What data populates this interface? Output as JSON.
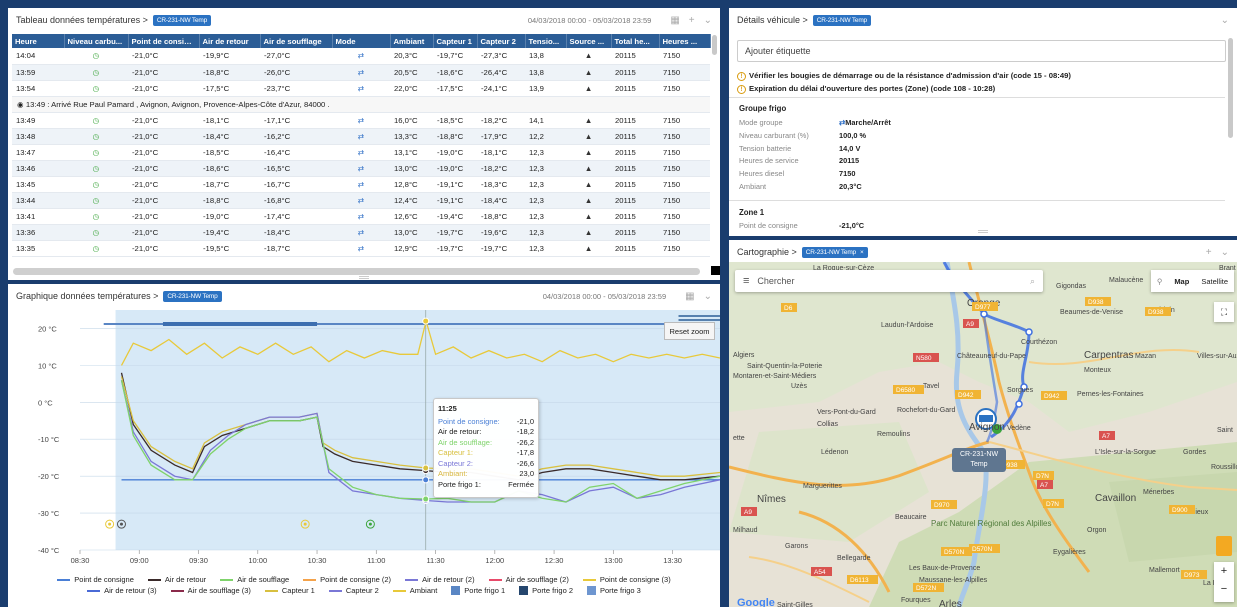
{
  "table_panel": {
    "title": "Tableau données températures >",
    "vehicle_badge": "CR-231-NW Temp",
    "date_range": "04/03/2018 00:00 - 05/03/2018 23:59",
    "columns": [
      "Heure",
      "Niveau carbu...",
      "Point de consign...",
      "Air de retour",
      "Air de soufflage",
      "Mode",
      "Ambiant",
      "Capteur 1",
      "Capteur 2",
      "Tensio...",
      "Source ...",
      "Total he...",
      "Heures ..."
    ],
    "rows_top": [
      [
        "14:04",
        "-21,0°C",
        "-19,9°C",
        "-27,0°C",
        "20,3°C",
        "-19,7°C",
        "-27,3°C",
        "13,8",
        "20115",
        "7150"
      ],
      [
        "13:59",
        "-21,0°C",
        "-18,8°C",
        "-26,0°C",
        "20,5°C",
        "-18,6°C",
        "-26,4°C",
        "13,8",
        "20115",
        "7150"
      ],
      [
        "13:54",
        "-21,0°C",
        "-17,5°C",
        "-23,7°C",
        "22,0°C",
        "-17,5°C",
        "-24,1°C",
        "13,9",
        "20115",
        "7150"
      ]
    ],
    "event_row": "13:49 : Arrivé Rue Paul Pamard , Avignon, Avignon, Provence-Alpes-Côte d'Azur, 84000 .",
    "rows_bottom": [
      [
        "13:49",
        "-21,0°C",
        "-18,1°C",
        "-17,1°C",
        "16,0°C",
        "-18,5°C",
        "-18,2°C",
        "14,1",
        "20115",
        "7150"
      ],
      [
        "13:48",
        "-21,0°C",
        "-18,4°C",
        "-16,2°C",
        "13,3°C",
        "-18,8°C",
        "-17,9°C",
        "12,2",
        "20115",
        "7150"
      ],
      [
        "13:47",
        "-21,0°C",
        "-18,5°C",
        "-16,4°C",
        "13,1°C",
        "-19,0°C",
        "-18,1°C",
        "12,3",
        "20115",
        "7150"
      ],
      [
        "13:46",
        "-21,0°C",
        "-18,6°C",
        "-16,5°C",
        "13,0°C",
        "-19,0°C",
        "-18,2°C",
        "12,3",
        "20115",
        "7150"
      ],
      [
        "13:45",
        "-21,0°C",
        "-18,7°C",
        "-16,7°C",
        "12,8°C",
        "-19,1°C",
        "-18,3°C",
        "12,3",
        "20115",
        "7150"
      ],
      [
        "13:44",
        "-21,0°C",
        "-18,8°C",
        "-16,8°C",
        "12,4°C",
        "-19,1°C",
        "-18,4°C",
        "12,3",
        "20115",
        "7150"
      ],
      [
        "13:41",
        "-21,0°C",
        "-19,0°C",
        "-17,4°C",
        "12,6°C",
        "-19,4°C",
        "-18,8°C",
        "12,3",
        "20115",
        "7150"
      ],
      [
        "13:36",
        "-21,0°C",
        "-19,4°C",
        "-18,4°C",
        "13,0°C",
        "-19,7°C",
        "-19,6°C",
        "12,3",
        "20115",
        "7150"
      ],
      [
        "13:35",
        "-21,0°C",
        "-19,5°C",
        "-18,7°C",
        "12,9°C",
        "-19,7°C",
        "-19,7°C",
        "12,3",
        "20115",
        "7150"
      ]
    ]
  },
  "chart_panel": {
    "title": "Graphique données températures >",
    "vehicle_badge": "CR-231-NW Temp",
    "date_range": "04/03/2018 00:00 - 05/03/2018 23:59",
    "reset_zoom": "Reset zoom",
    "tooltip": {
      "time": "11:25",
      "rows": [
        {
          "label": "Point de consigne:",
          "value": "-21,0",
          "color": "#4a7fd6"
        },
        {
          "label": "Air de retour:",
          "value": "-18,2",
          "color": "#222"
        },
        {
          "label": "Air de soufflage:",
          "value": "-26,2",
          "color": "#7fd36b"
        },
        {
          "label": "Capteur 1:",
          "value": "-17,8",
          "color": "#d8c040"
        },
        {
          "label": "Capteur 2:",
          "value": "-26,6",
          "color": "#7a77d6"
        },
        {
          "label": "Ambiant:",
          "value": "23,0",
          "color": "#d8b740"
        },
        {
          "label": "Porte frigo 1:",
          "value": "Fermée",
          "color": "#222"
        }
      ]
    },
    "legend": [
      {
        "label": "Point de consigne",
        "color": "#4a7fd6",
        "kind": "line"
      },
      {
        "label": "Air de retour",
        "color": "#3a2a2a",
        "kind": "line"
      },
      {
        "label": "Air de soufflage",
        "color": "#7fd36b",
        "kind": "line"
      },
      {
        "label": "Point de consigne (2)",
        "color": "#f4a24a",
        "kind": "line"
      },
      {
        "label": "Air de retour (2)",
        "color": "#7a77d6",
        "kind": "line"
      },
      {
        "label": "Air de soufflage (2)",
        "color": "#e84a6a",
        "kind": "line"
      },
      {
        "label": "Point de consigne (3)",
        "color": "#e8c93a",
        "kind": "line"
      },
      {
        "label": "Air de retour (3)",
        "color": "#4a6ad6",
        "kind": "line"
      },
      {
        "label": "Air de soufflage (3)",
        "color": "#8a2a4a",
        "kind": "line"
      },
      {
        "label": "Capteur 1",
        "color": "#d8c040",
        "kind": "line"
      },
      {
        "label": "Capteur 2",
        "color": "#7a77d6",
        "kind": "line"
      },
      {
        "label": "Ambiant",
        "color": "#e8c93a",
        "kind": "line"
      },
      {
        "label": "Porte frigo 1",
        "color": "#5a86c4",
        "kind": "box"
      },
      {
        "label": "Porte frigo 2",
        "color": "#25466e",
        "kind": "box"
      },
      {
        "label": "Porte frigo 3",
        "color": "#6e96d0",
        "kind": "box"
      }
    ]
  },
  "chart_data": {
    "type": "line",
    "x_ticks": [
      "08:30",
      "09:00",
      "09:30",
      "10:00",
      "10:30",
      "11:00",
      "11:30",
      "12:00",
      "12:30",
      "13:00",
      "13:30"
    ],
    "y_ticks": [
      "20 °C",
      "10 °C",
      "0 °C",
      "-10 °C",
      "-20 °C",
      "-30 °C",
      "-40 °C"
    ],
    "ylim": [
      -40,
      25
    ],
    "xlim_hours": [
      8.5,
      13.9
    ],
    "highlight_range": [
      8.8,
      13.9
    ],
    "crosshair_x": 11.417,
    "series": [
      {
        "name": "Ambiant",
        "color": "#e8c93a",
        "x": [
          8.85,
          8.95,
          9.1,
          9.25,
          9.4,
          9.55,
          9.7,
          9.85,
          10.0,
          10.15,
          10.3,
          10.45,
          10.6,
          10.75,
          10.9,
          11.05,
          11.2,
          11.35,
          11.42,
          11.5,
          11.65,
          11.8,
          11.95,
          12.1,
          12.25,
          12.4,
          12.55,
          12.7,
          12.85,
          13.0,
          13.15,
          13.3,
          13.45,
          13.6,
          13.75,
          13.9
        ],
        "y": [
          10,
          16,
          14,
          17,
          13,
          16,
          12,
          15,
          13,
          16,
          13,
          15,
          11,
          14,
          12,
          14,
          13,
          13,
          22,
          13,
          15,
          12,
          14,
          12,
          13,
          11,
          14,
          12,
          13,
          11,
          13,
          12,
          13,
          12,
          13,
          12
        ]
      },
      {
        "name": "Point de consigne",
        "color": "#4a7fd6",
        "x": [
          8.85,
          13.9
        ],
        "y": [
          -21,
          -21
        ]
      },
      {
        "name": "Air de retour",
        "color": "#3a2a2a",
        "x": [
          8.85,
          8.95,
          9.1,
          9.3,
          9.45,
          9.55,
          9.7,
          9.9,
          10.1,
          10.35,
          10.5,
          10.55,
          10.65,
          10.8,
          11.0,
          11.2,
          11.42,
          11.6,
          11.8,
          12.0,
          12.2,
          12.4,
          12.6,
          12.8,
          13.0,
          13.2,
          13.4,
          13.6,
          13.9
        ],
        "y": [
          8,
          -6,
          -13,
          -17,
          -19,
          -12,
          -9,
          -7,
          -5,
          -5,
          -4,
          -12,
          -14,
          -16,
          -17,
          -18,
          -18.5,
          -19,
          -19,
          -20,
          -21,
          -19,
          -18,
          -18,
          -19,
          -20,
          -21,
          -21,
          -20
        ]
      },
      {
        "name": "Capteur 1",
        "color": "#d8c040",
        "x": [
          8.85,
          8.95,
          9.1,
          9.3,
          9.45,
          9.55,
          9.7,
          9.9,
          10.1,
          10.35,
          10.5,
          10.55,
          10.65,
          10.8,
          11.0,
          11.2,
          11.42,
          11.6,
          11.8,
          12.0,
          12.2,
          12.4,
          12.6,
          12.8,
          13.0,
          13.2,
          13.4,
          13.6,
          13.9
        ],
        "y": [
          7,
          -5,
          -12,
          -16,
          -18,
          -11,
          -8,
          -6,
          -4,
          -4,
          -3,
          -11,
          -13,
          -15,
          -16,
          -17,
          -17.8,
          -18,
          -18,
          -19,
          -20,
          -18,
          -17,
          -17,
          -18,
          -19,
          -20,
          -20,
          -19
        ]
      },
      {
        "name": "Capteur 2",
        "color": "#7a77d6",
        "x": [
          8.85,
          8.95,
          9.1,
          9.3,
          9.45,
          9.6,
          9.75,
          9.9,
          10.1,
          10.35,
          10.5,
          10.6,
          10.8,
          11.0,
          11.2,
          11.42,
          11.6,
          11.8,
          12.0,
          12.2,
          12.4,
          12.6,
          12.8,
          13.0,
          13.2,
          13.4,
          13.6,
          13.9
        ],
        "y": [
          6,
          -8,
          -16,
          -20,
          -21,
          -13,
          -9,
          -6,
          -4,
          -4,
          -3,
          -19,
          -24,
          -25,
          -26,
          -26.6,
          -27,
          -27,
          -27,
          -24,
          -25,
          -27,
          -24,
          -23,
          -26,
          -25,
          -23,
          -21
        ]
      },
      {
        "name": "Air de soufflage",
        "color": "#7fd36b",
        "x": [
          8.85,
          8.95,
          9.1,
          9.3,
          9.45,
          9.6,
          9.75,
          9.9,
          10.1,
          10.35,
          10.5,
          10.6,
          10.8,
          11.0,
          11.2,
          11.42,
          11.6,
          11.8,
          12.0,
          12.2,
          12.4,
          12.6,
          12.8,
          13.0,
          13.2,
          13.4,
          13.6,
          13.9
        ],
        "y": [
          6,
          -9,
          -17,
          -21,
          -21,
          -14,
          -10,
          -7,
          -5,
          -5,
          -4,
          -18,
          -23,
          -25,
          -26,
          -26.2,
          -26,
          -27,
          -27,
          -24,
          -26,
          -27,
          -23,
          -22,
          -26,
          -24,
          -22,
          -20
        ]
      }
    ]
  },
  "details_panel": {
    "title": "Détails véhicule >",
    "vehicle_badge": "CR-231-NW Temp",
    "tag_placeholder": "Ajouter étiquette",
    "warnings": [
      "Vérifier les bougies de démarrage ou de la résistance d'admission d'air (code 15 - 08:49)",
      "Expiration du délai d'ouverture des portes (Zone) (code 108 - 10:28)"
    ],
    "group_title": "Groupe frigo",
    "group_rows": [
      {
        "k": "Mode groupe",
        "v": "Marche/Arrêt"
      },
      {
        "k": "Niveau carburant (%)",
        "v": "100,0 %"
      },
      {
        "k": "Tension batterie",
        "v": "14,0 V"
      },
      {
        "k": "Heures de service",
        "v": "20115"
      },
      {
        "k": "Heures diesel",
        "v": "7150"
      },
      {
        "k": "Ambiant",
        "v": "20,3°C"
      }
    ],
    "zone_title": "Zone 1",
    "zone_rows": [
      {
        "k": "Point de consigne",
        "v": "-21,0°C"
      }
    ]
  },
  "map_panel": {
    "title": "Cartographie >",
    "vehicle_badge": "CR-231-NW Temp",
    "search_placeholder": "Chercher",
    "map_label": "Map",
    "satellite_label": "Satellite",
    "truck_label_1": "CR-231-NW",
    "truck_label_2": "Temp",
    "google": "Google",
    "places": [
      "La Roque-sur-Cèze",
      "Malaucène",
      "Gigondas",
      "Orange",
      "Beaumes-de-Venise",
      "Bédoin",
      "Laudun-l'Ardoise",
      "Courthézon",
      "Algiers",
      "Saint-Quentin-la-Poterie",
      "Châteauneuf-du-Pape",
      "Carpentras",
      "Mazan",
      "Villes-sur-Auzon",
      "Montaren-et-Saint-Médiers",
      "Uzès",
      "Monteux",
      "Tavel",
      "Sorgues",
      "Pernes-les-Fontaines",
      "Vers-Pont-du-Gard",
      "Rochefort-du-Gard",
      "Vedène",
      "Collias",
      "Remoulins",
      "Avignon",
      "L'Isle-sur-la-Sorgue",
      "Gordes",
      "Roussillon",
      "Lédenon",
      "Marguerittes",
      "Nîmes",
      "Cavaillon",
      "Ménerbes",
      "Bonnieux",
      "Beaucaire",
      "Parc Naturel Régional des Alpilles",
      "Orgon",
      "Milhaud",
      "Garons",
      "Bellegarde",
      "Eygalières",
      "Les Baux-de-Provence",
      "Maussane-les-Alpilles",
      "Mallemort",
      "La Roque",
      "Saint-Gilles",
      "Fourques",
      "Arles",
      "Brant",
      "Saint",
      "ette"
    ],
    "roads": [
      "D6",
      "D977",
      "D938",
      "D938",
      "A9",
      "D942",
      "N580",
      "D6580",
      "D942",
      "A7",
      "D938",
      "D7N",
      "D900",
      "D973",
      "D570N",
      "A54",
      "D6113",
      "D572N",
      "D570N",
      "D970",
      "A9",
      "A7",
      "D7N"
    ]
  }
}
